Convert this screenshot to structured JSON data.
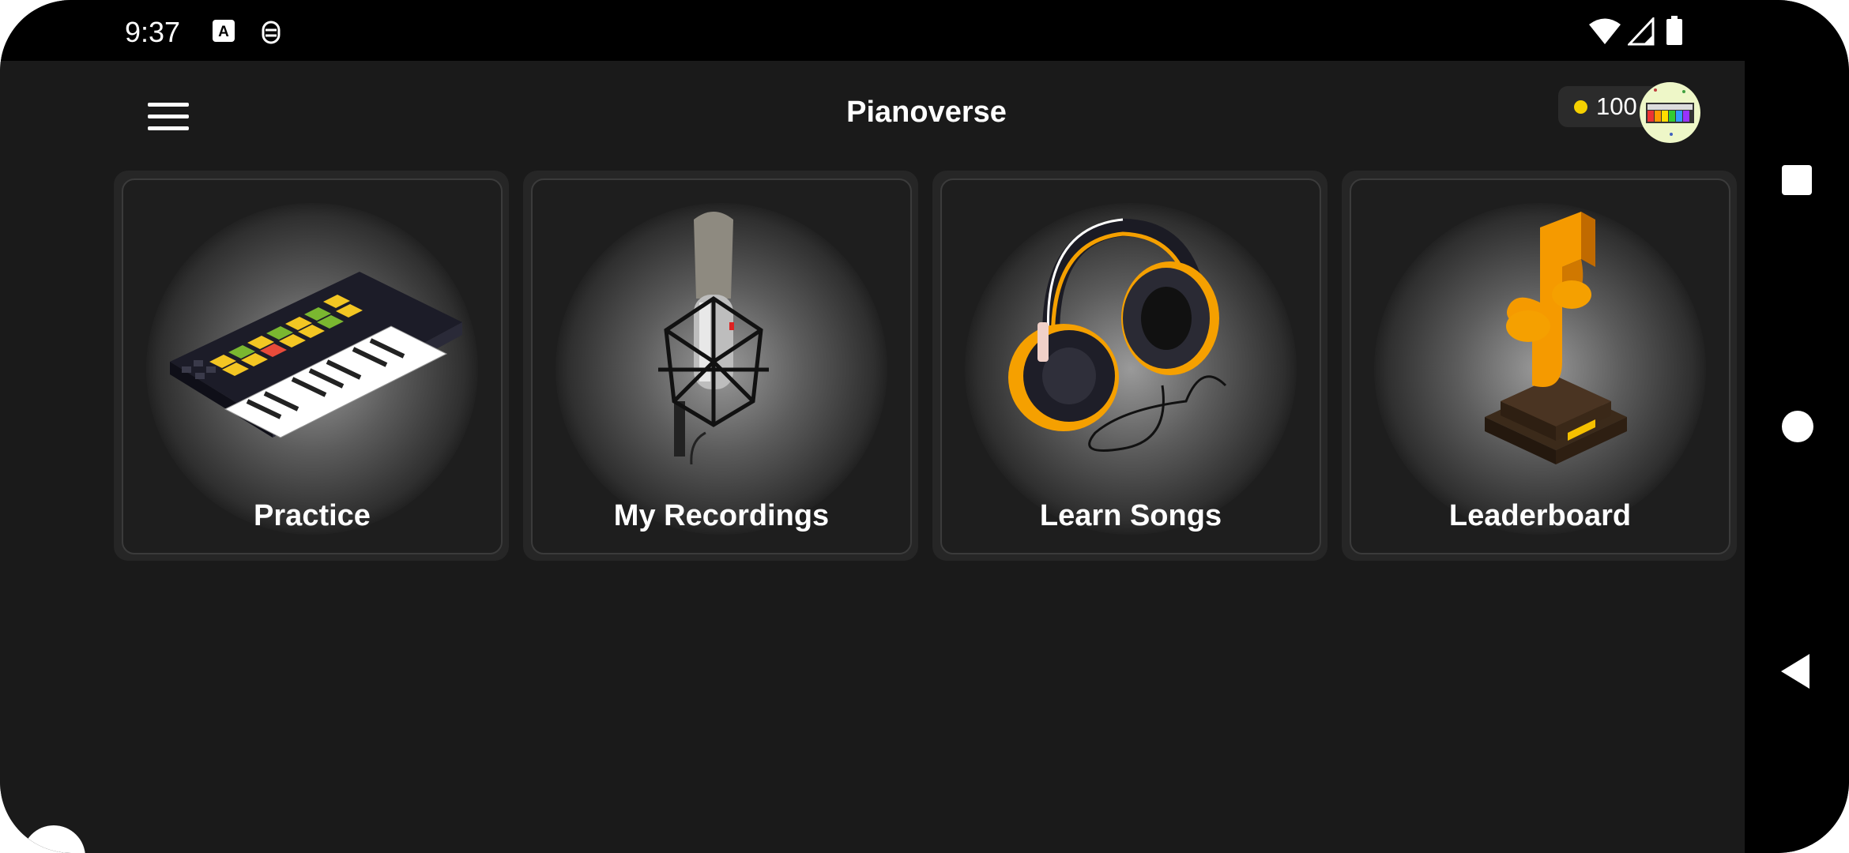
{
  "status_bar": {
    "time": "9:37",
    "left_icons": [
      "text-notification-icon",
      "robot-notification-icon"
    ],
    "right_icons": [
      "wifi-icon",
      "signal-icon",
      "battery-icon"
    ]
  },
  "header": {
    "menu_icon": "hamburger-menu-icon",
    "title": "Pianoverse",
    "coins": "100",
    "coin_color": "#f5d000"
  },
  "cards": [
    {
      "label": "Practice",
      "icon": "keyboard-icon"
    },
    {
      "label": "My Recordings",
      "icon": "microphone-icon"
    },
    {
      "label": "Learn Songs",
      "icon": "headphones-icon"
    },
    {
      "label": "Leaderboard",
      "icon": "trophy-icon"
    }
  ],
  "nav_bar": {
    "buttons": [
      "recents-button",
      "home-button",
      "back-button"
    ]
  },
  "colors": {
    "background": "#1a1a1a",
    "card": "#262626",
    "accent": "#f5a000"
  }
}
